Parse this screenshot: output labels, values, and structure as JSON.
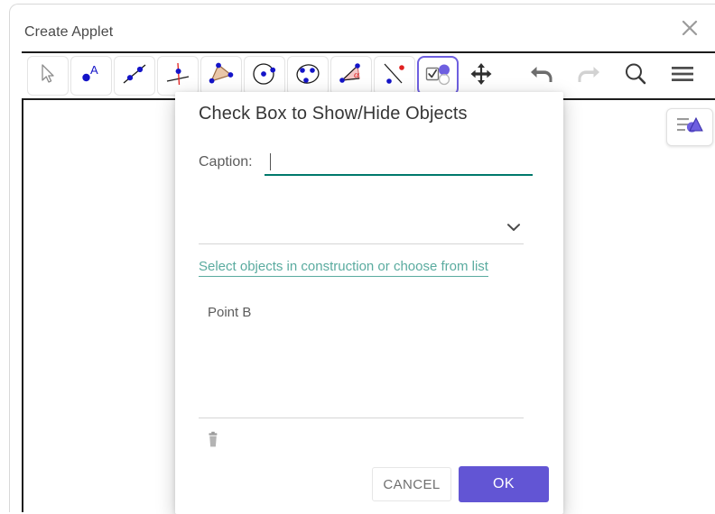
{
  "window": {
    "title": "Create Applet",
    "close_icon": "close-icon"
  },
  "toolbar": {
    "tools": [
      {
        "name": "move-tool",
        "icon": "arrow-cursor-icon",
        "selected": false
      },
      {
        "name": "point-tool",
        "icon": "point-with-label-icon",
        "selected": false
      },
      {
        "name": "line-tool",
        "icon": "line-through-points-icon",
        "selected": false
      },
      {
        "name": "perpendicular-line-tool",
        "icon": "perpendicular-line-icon",
        "selected": false
      },
      {
        "name": "polygon-tool",
        "icon": "polygon-icon",
        "selected": false
      },
      {
        "name": "circle-tool",
        "icon": "circle-icon",
        "selected": false
      },
      {
        "name": "conic-tool",
        "icon": "ellipse-icon",
        "selected": false
      },
      {
        "name": "angle-tool",
        "icon": "angle-alpha-icon",
        "selected": false
      },
      {
        "name": "reflect-tool",
        "icon": "reflect-about-line-icon",
        "selected": false
      },
      {
        "name": "checkbox-tool",
        "icon": "checkbox-show-hide-icon",
        "selected": true
      },
      {
        "name": "move-graphics-tool",
        "icon": "move-arrows-icon",
        "selected": false
      }
    ],
    "actions": [
      {
        "name": "undo-button",
        "icon": "undo-icon",
        "disabled": true
      },
      {
        "name": "redo-button",
        "icon": "redo-icon",
        "disabled": true
      },
      {
        "name": "search-button",
        "icon": "search-icon",
        "disabled": false
      },
      {
        "name": "menu-button",
        "icon": "hamburger-menu-icon",
        "disabled": false
      }
    ]
  },
  "canvas": {
    "style_bar_icon": "style-bar-icon"
  },
  "dialog": {
    "title": "Check Box to Show/Hide Objects",
    "caption_label": "Caption:",
    "caption_value": "",
    "caption_placeholder": "",
    "object_select_value": "",
    "object_select_icon": "chevron-down-icon",
    "link_text": "Select objects in construction or choose from list",
    "list_items": [
      {
        "label": "Point B"
      }
    ],
    "delete_icon": "trash-icon",
    "cancel_label": "CANCEL",
    "ok_label": "OK"
  },
  "colors": {
    "primary": "#6255d4",
    "accent_teal": "#00796b",
    "link_teal": "#5aab9f",
    "tool_selected_border": "#6e5fe0"
  }
}
